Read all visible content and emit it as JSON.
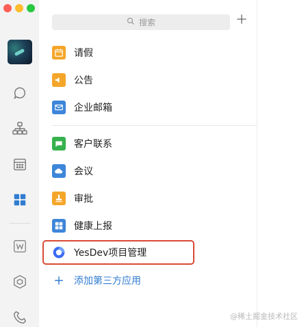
{
  "window": {
    "controls": [
      "close",
      "minimize",
      "zoom"
    ]
  },
  "left_rail": {
    "items": [
      {
        "name": "chat-icon"
      },
      {
        "name": "org-chart-icon"
      },
      {
        "name": "calendar-icon"
      },
      {
        "name": "apps-grid-icon"
      },
      {
        "name": "w-app-icon"
      },
      {
        "name": "cube-icon"
      },
      {
        "name": "phone-icon"
      }
    ]
  },
  "search": {
    "placeholder": "搜索"
  },
  "apps": [
    {
      "label": "请假",
      "icon": "calendar-icon",
      "color": "#f4a62a"
    },
    {
      "label": "公告",
      "icon": "megaphone-icon",
      "color": "#f4a62a"
    },
    {
      "label": "企业邮箱",
      "icon": "mail-icon",
      "color": "#3d86d9"
    },
    {
      "label": "客户联系",
      "icon": "chat-bubble-icon",
      "color": "#36b14e"
    },
    {
      "label": "会议",
      "icon": "cloud-icon",
      "color": "#3d86d9"
    },
    {
      "label": "审批",
      "icon": "stamp-icon",
      "color": "#f4a62a"
    },
    {
      "label": "健康上报",
      "icon": "grid-icon",
      "color": "#3d86d9"
    },
    {
      "label": "YesDev项目管理",
      "icon": "yesdev-logo-icon",
      "color": "#3b6cf5"
    }
  ],
  "add_app": {
    "label": "添加第三方应用"
  },
  "watermark": {
    "text": "@稀土掘金技术社区"
  }
}
